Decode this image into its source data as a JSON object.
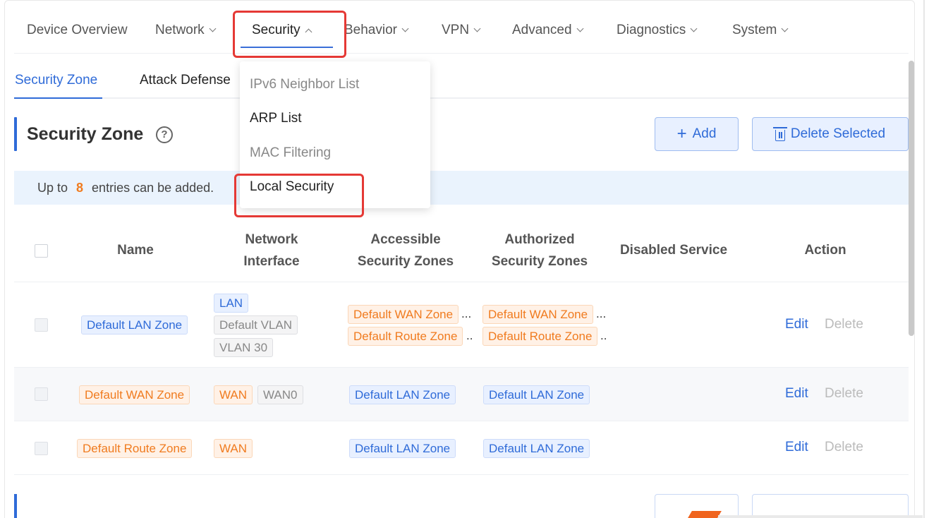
{
  "nav": {
    "items": [
      {
        "label": "Device Overview"
      },
      {
        "label": "Network"
      },
      {
        "label": "Security"
      },
      {
        "label": "Behavior"
      },
      {
        "label": "VPN"
      },
      {
        "label": "Advanced"
      },
      {
        "label": "Diagnostics"
      },
      {
        "label": "System"
      }
    ],
    "active": "Security"
  },
  "subtabs": [
    {
      "label": "Security Zone"
    },
    {
      "label": "Attack Defense"
    }
  ],
  "dropdown": {
    "items": [
      {
        "label": "IPv6 Neighbor List"
      },
      {
        "label": "ARP List"
      },
      {
        "label": "MAC Filtering"
      },
      {
        "label": "Local Security"
      }
    ],
    "highlighted": "Local Security"
  },
  "section": {
    "title": "Security Zone",
    "help": "?",
    "add_label": "Add",
    "add_icon": "+",
    "delete_label": "Delete Selected"
  },
  "banner": {
    "prefix": "Up to",
    "count": "8",
    "suffix": "entries can be added."
  },
  "table": {
    "columns": [
      {
        "label": "Name"
      },
      {
        "label": "Network\nInterface"
      },
      {
        "label": "Accessible\nSecurity Zones"
      },
      {
        "label": "Authorized\nSecurity Zones"
      },
      {
        "label": "Disabled Service"
      },
      {
        "label": "Action"
      }
    ],
    "rows": [
      {
        "name": "Default LAN Zone",
        "interfaces": [
          "LAN",
          "Default VLAN",
          "VLAN 30"
        ],
        "accessible": [
          "Default WAN Zone",
          "Default Route Zone"
        ],
        "authorized": [
          "Default WAN Zone",
          "Default Route Zone"
        ],
        "ellipsis_1": "...",
        "ellipsis_2": "..",
        "disabled_service": "",
        "edit": "Edit",
        "delete": "Delete"
      },
      {
        "name": "Default WAN Zone",
        "interfaces": [
          "WAN",
          "WAN0"
        ],
        "accessible": [
          "Default LAN Zone"
        ],
        "authorized": [
          "Default LAN Zone"
        ],
        "disabled_service": "",
        "edit": "Edit",
        "delete": "Delete"
      },
      {
        "name": "Default Route Zone",
        "interfaces": [
          "WAN"
        ],
        "accessible": [
          "Default LAN Zone"
        ],
        "authorized": [
          "Default LAN Zone"
        ],
        "disabled_service": "",
        "edit": "Edit",
        "delete": "Delete"
      }
    ]
  },
  "colors": {
    "accent": "#2f6bd8",
    "highlight_box": "#e53935",
    "orange": "#f07b1f"
  }
}
